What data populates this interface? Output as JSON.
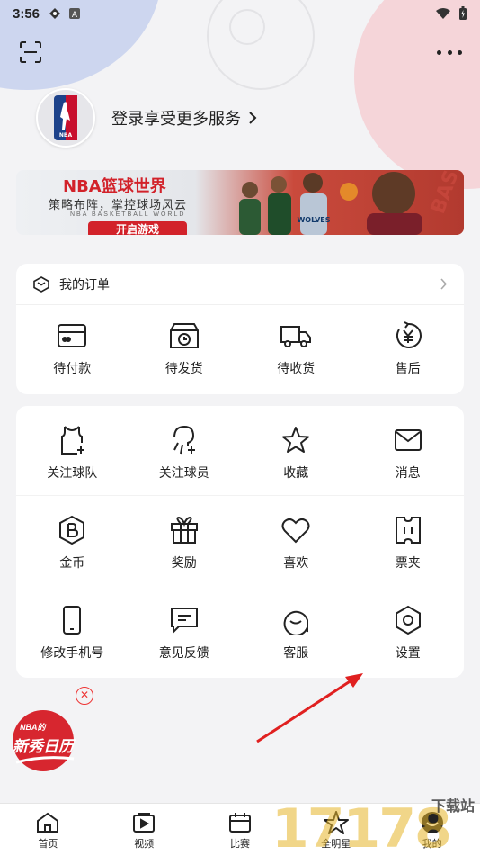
{
  "status_bar": {
    "time": "3:56"
  },
  "login": {
    "prompt": "登录享受更多服务"
  },
  "banner": {
    "title": "NBA篮球世界",
    "slogan": "策略布阵，掌控球场风云",
    "subtitle": "NBA BASKETBALL WORLD",
    "cta": "开启游戏"
  },
  "orders": {
    "header": "我的订单",
    "items": [
      {
        "label": "待付款",
        "icon": "card-icon"
      },
      {
        "label": "待发货",
        "icon": "box-clock-icon"
      },
      {
        "label": "待收货",
        "icon": "truck-icon"
      },
      {
        "label": "售后",
        "icon": "yuan-refresh-icon"
      }
    ]
  },
  "tools": {
    "rows": [
      [
        {
          "label": "关注球队",
          "icon": "jersey-plus-icon"
        },
        {
          "label": "关注球员",
          "icon": "player-plus-icon"
        },
        {
          "label": "收藏",
          "icon": "star-icon"
        },
        {
          "label": "消息",
          "icon": "mail-icon"
        }
      ],
      [
        {
          "label": "金币",
          "icon": "coin-icon"
        },
        {
          "label": "奖励",
          "icon": "gift-icon"
        },
        {
          "label": "喜欢",
          "icon": "heart-icon"
        },
        {
          "label": "票夹",
          "icon": "ticket-icon"
        }
      ],
      [
        {
          "label": "修改手机号",
          "icon": "phone-icon"
        },
        {
          "label": "意见反馈",
          "icon": "feedback-icon"
        },
        {
          "label": "客服",
          "icon": "chat-icon"
        },
        {
          "label": "设置",
          "icon": "settings-icon"
        }
      ]
    ]
  },
  "rookie_badge": {
    "small": "NBA的",
    "main": "新秀日历"
  },
  "tabbar": {
    "items": [
      {
        "label": "首页",
        "icon": "home-icon"
      },
      {
        "label": "视频",
        "icon": "video-icon"
      },
      {
        "label": "比赛",
        "icon": "calendar-icon"
      },
      {
        "label": "全明星",
        "icon": "allstar-icon"
      },
      {
        "label": "我的",
        "icon": "profile-icon"
      }
    ]
  },
  "watermark": {
    "number": "17178",
    "text": "下载站"
  },
  "colors": {
    "accent_red": "#d2222a",
    "arrow_red": "#e02020",
    "text": "#222222",
    "background": "#f3f3f5"
  }
}
